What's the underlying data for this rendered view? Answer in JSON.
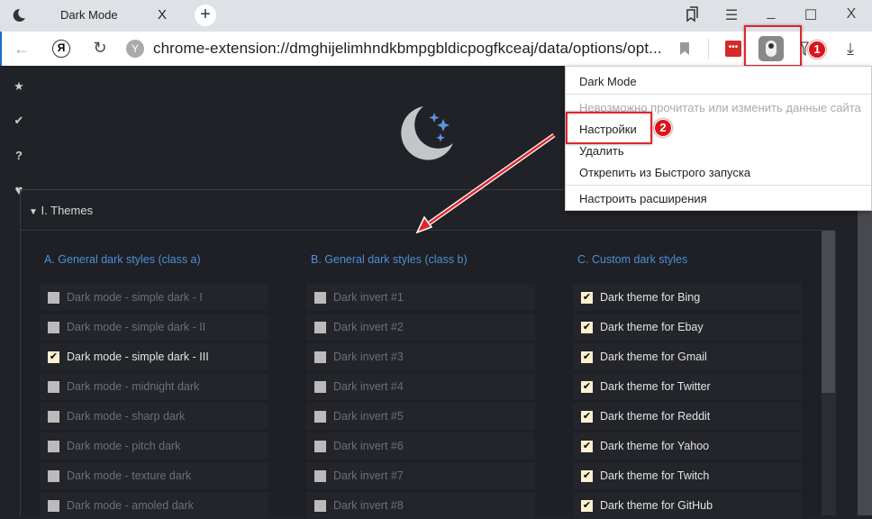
{
  "tab": {
    "title": "Dark Mode",
    "close": "X",
    "new": "+"
  },
  "window": {
    "minimize": "_",
    "maximize": "☐",
    "close": "X",
    "menu": "☰"
  },
  "address": {
    "url": "chrome-extension://dmghijelimhndkbmpgbldicpogfkceaj/data/options/opt...",
    "yandex": "Я"
  },
  "menu": {
    "items": [
      "Dark Mode",
      "Невозможно прочитать или изменить данные сайта",
      "Настройки",
      "Удалить",
      "Открепить из Быстрого запуска",
      "Настроить расширения"
    ]
  },
  "annotations": {
    "badge1": "1",
    "badge2": "2",
    "color": "#e0262c"
  },
  "sidebar": {
    "icons": [
      "star-icon",
      "check-icon",
      "question-icon",
      "heart-icon"
    ],
    "question": "?"
  },
  "section": {
    "title": "I. Themes",
    "toggle": "▼"
  },
  "columns": [
    {
      "title": "A. General dark styles (class a)",
      "items": [
        {
          "label": "Dark mode - simple dark - I",
          "checked": false
        },
        {
          "label": "Dark mode - simple dark - II",
          "checked": false
        },
        {
          "label": "Dark mode - simple dark - III",
          "checked": true
        },
        {
          "label": "Dark mode - midnight dark",
          "checked": false
        },
        {
          "label": "Dark mode - sharp dark",
          "checked": false
        },
        {
          "label": "Dark mode - pitch dark",
          "checked": false
        },
        {
          "label": "Dark mode - texture dark",
          "checked": false
        },
        {
          "label": "Dark mode - amoled dark",
          "checked": false
        }
      ]
    },
    {
      "title": "B. General dark styles (class b)",
      "items": [
        {
          "label": "Dark invert #1",
          "checked": false
        },
        {
          "label": "Dark invert #2",
          "checked": false
        },
        {
          "label": "Dark invert #3",
          "checked": false
        },
        {
          "label": "Dark invert #4",
          "checked": false
        },
        {
          "label": "Dark invert #5",
          "checked": false
        },
        {
          "label": "Dark invert #6",
          "checked": false
        },
        {
          "label": "Dark invert #7",
          "checked": false
        },
        {
          "label": "Dark invert #8",
          "checked": false
        }
      ]
    },
    {
      "title": "C. Custom dark styles",
      "items": [
        {
          "label": "Dark theme for Bing",
          "checked": true
        },
        {
          "label": "Dark theme for Ebay",
          "checked": true
        },
        {
          "label": "Dark theme for Gmail",
          "checked": true
        },
        {
          "label": "Dark theme for Twitter",
          "checked": true
        },
        {
          "label": "Dark theme for Reddit",
          "checked": true
        },
        {
          "label": "Dark theme for Yahoo",
          "checked": true
        },
        {
          "label": "Dark theme for Twitch",
          "checked": true
        },
        {
          "label": "Dark theme for GitHub",
          "checked": true
        }
      ]
    }
  ]
}
